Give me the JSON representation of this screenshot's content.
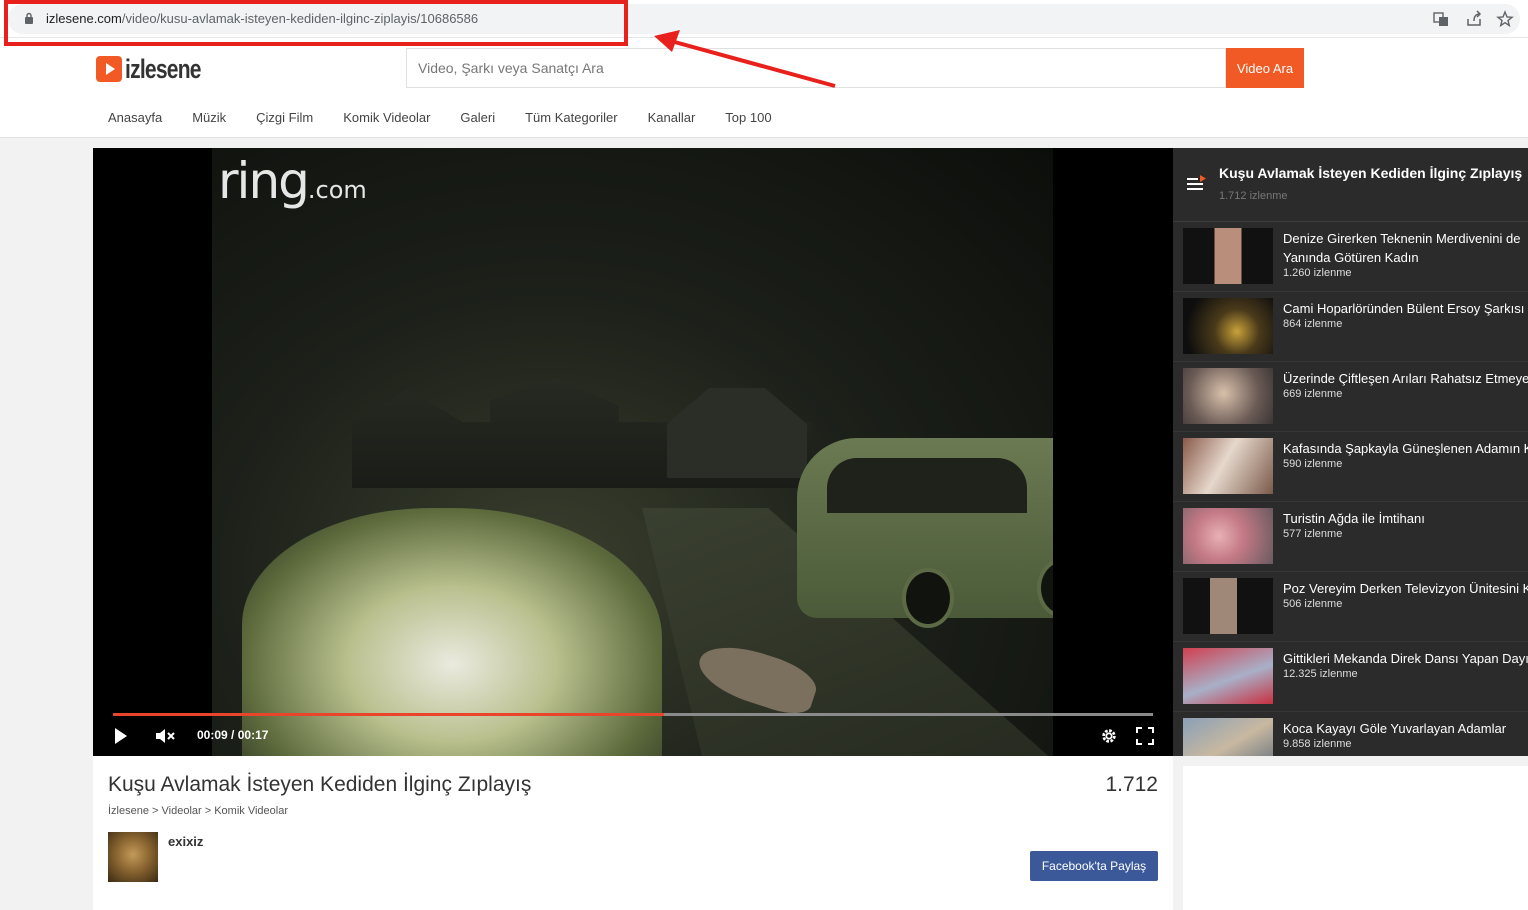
{
  "browser": {
    "url_host": "izlesene.com",
    "url_path": "/video/kusu-avlamak-isteyen-kediden-ilginc-ziplayis/10686586",
    "icons": [
      "lock-icon",
      "translate-icon",
      "share-icon",
      "bookmark-star-icon"
    ]
  },
  "site": {
    "logo_text": "izlesene",
    "search_placeholder": "Video, Şarkı veya Sanatçı Ara",
    "search_button": "Video Ara",
    "nav": [
      "Anasayfa",
      "Müzik",
      "Çizgi Film",
      "Komik Videolar",
      "Galeri",
      "Tüm Kategoriler",
      "Kanallar",
      "Top 100"
    ],
    "accent_color": "#f15a24"
  },
  "player": {
    "watermark": "ring",
    "watermark_suffix": ".com",
    "current_time": "00:09",
    "duration": "00:17",
    "progress_fraction": 0.53,
    "icons": [
      "play-icon",
      "mute-icon",
      "settings-gear-icon",
      "fullscreen-icon"
    ]
  },
  "playlist": {
    "title": "Kuşu Avlamak İsteyen Kediden İlginç Zıplayış",
    "views": "1.712 izlenme",
    "items": [
      {
        "title": "Denize Girerken Teknenin Merdivenini de Yanında Götüren Kadın",
        "views": "1.260 izlenme"
      },
      {
        "title": "Cami Hoparlöründen Bülent Ersoy Şarkısı",
        "views": "864 izlenme"
      },
      {
        "title": "Üzerinde Çiftleşen Arıları Rahatsız Etmeyen",
        "views": "669 izlenme"
      },
      {
        "title": "Kafasında Şapkayla Güneşlenen Adamın K",
        "views": "590 izlenme"
      },
      {
        "title": "Turistin Ağda ile İmtihanı",
        "views": "577 izlenme"
      },
      {
        "title": "Poz Vereyim Derken Televizyon Ünitesini K",
        "views": "506 izlenme"
      },
      {
        "title": "Gittikleri Mekanda Direk Dansı Yapan Dayı",
        "views": "12.325 izlenme"
      },
      {
        "title": "Koca Kayayı Göle Yuvarlayan Adamlar",
        "views": "9.858 izlenme"
      }
    ]
  },
  "video": {
    "title": "Kuşu Avlamak İsteyen Kediden İlginç Zıplayış",
    "view_count": "1.712",
    "breadcrumb": "İzlesene > Videolar > Komik Videolar",
    "uploader": "exixiz",
    "share_button": "Facebook'ta Paylaş",
    "share_color": "#3b5998"
  }
}
